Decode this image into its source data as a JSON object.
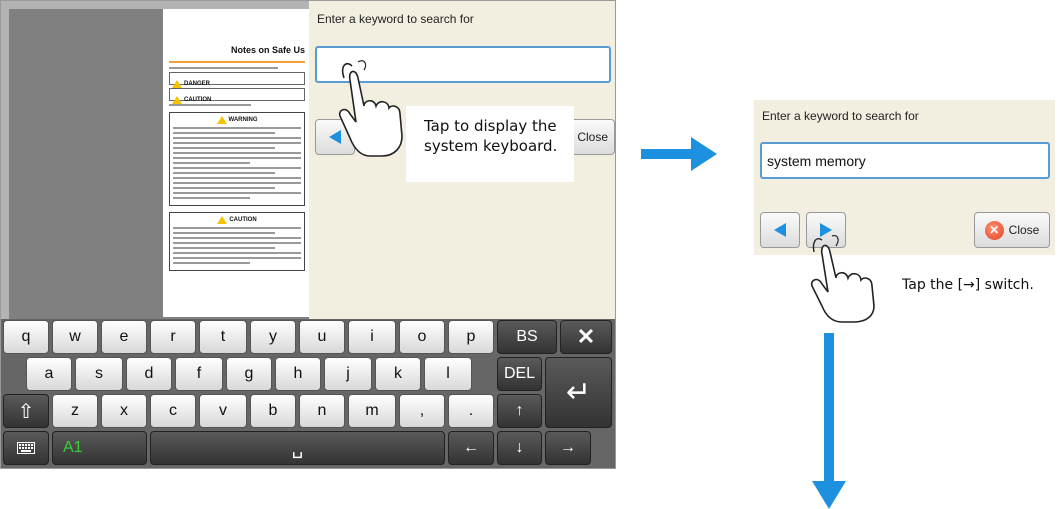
{
  "document": {
    "title": "Notes on Safe Us",
    "danger_label": "DANGER",
    "caution_label": "CAUTION",
    "section_warning": "WARNING",
    "section_caution": "CAUTION"
  },
  "left_screen": {
    "search_prompt": "Enter a keyword to search for",
    "search_value": "",
    "close_label": "Close",
    "callout_line1": "Tap to display the",
    "callout_line2": "system keyboard."
  },
  "keyboard": {
    "row1": [
      "q",
      "w",
      "e",
      "r",
      "t",
      "y",
      "u",
      "i",
      "o",
      "p"
    ],
    "row2": [
      "a",
      "s",
      "d",
      "f",
      "g",
      "h",
      "j",
      "k",
      "l"
    ],
    "row3": [
      "z",
      "x",
      "c",
      "v",
      "b",
      "n",
      "m",
      ",",
      "."
    ],
    "bs_label": "BS",
    "del_label": "DEL",
    "close_glyph": "✕",
    "enter_glyph": "↵",
    "shift_glyph": "⇧",
    "mode_label": "A1",
    "space_glyph": "␣",
    "left_glyph": "←",
    "right_glyph": "→",
    "up_glyph": "↑",
    "down_glyph": "↓",
    "keyboard_icon": "keyboard-icon"
  },
  "right_panel": {
    "search_prompt": "Enter a keyword to search for",
    "search_value": "system memory",
    "close_label": "Close",
    "caption": "Tap the [→] switch."
  },
  "colors": {
    "accent_blue": "#1e90e0",
    "panel_bg": "#f2eee0",
    "close_red": "#e0452a",
    "field_border": "#5b9bd5"
  }
}
